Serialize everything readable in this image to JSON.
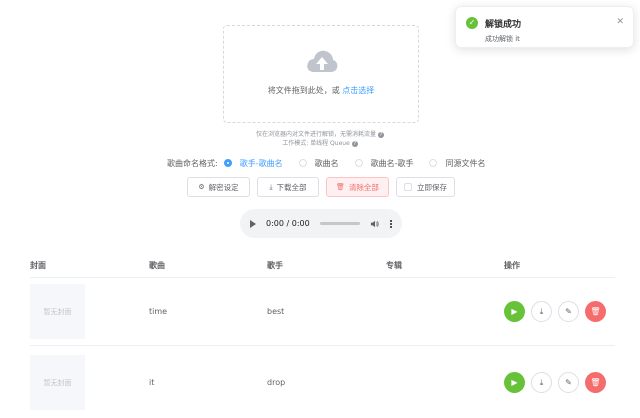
{
  "upload": {
    "text": "将文件拖到此处，或",
    "link": "点击选择",
    "icon": "cloud-upload-icon"
  },
  "hints": {
    "line1": "仅在浏览器内对文件进行解锁，无需消耗流量",
    "line2": "工作模式: 单线程 Queue"
  },
  "naming": {
    "label": "歌曲命名格式:",
    "options": [
      "歌手-歌曲名",
      "歌曲名",
      "歌曲名-歌手",
      "同源文件名"
    ],
    "selected": "歌手-歌曲名"
  },
  "buttons": {
    "settings": "解密设定",
    "download_all": "下载全部",
    "clear_all": "清除全部",
    "save_now": "立即保存"
  },
  "audio": {
    "time": "0:00 / 0:00"
  },
  "table": {
    "headers": [
      "封面",
      "歌曲",
      "歌手",
      "专辑",
      "操作"
    ],
    "rows": [
      {
        "cover": "暂无封面",
        "song": "time",
        "artist": "best",
        "album": ""
      },
      {
        "cover": "暂无封面",
        "song": "it",
        "artist": "drop",
        "album": ""
      }
    ]
  },
  "toast": {
    "title": "解锁成功",
    "message": "成功解锁 it"
  },
  "colors": {
    "primary": "#409eff",
    "success": "#67c23a",
    "danger": "#f56c6c"
  }
}
